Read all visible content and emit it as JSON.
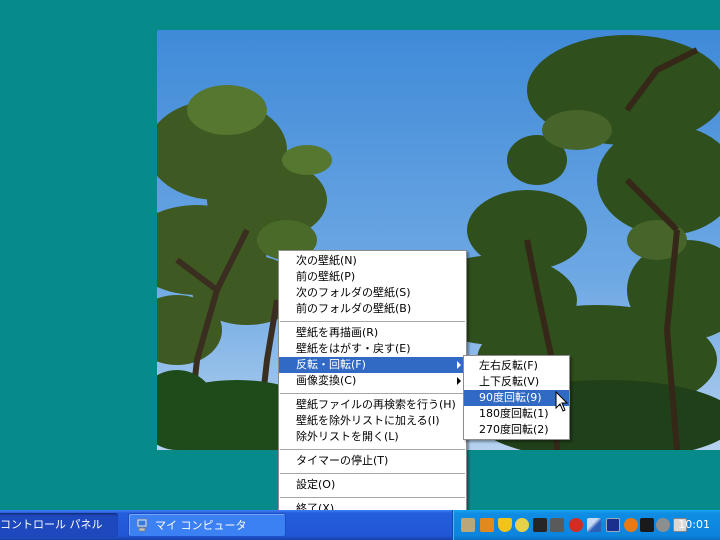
{
  "context_menu": {
    "items": [
      {
        "label": "次の壁紙(N)"
      },
      {
        "label": "前の壁紙(P)"
      },
      {
        "label": "次のフォルダの壁紙(S)"
      },
      {
        "label": "前のフォルダの壁紙(B)"
      },
      {
        "separator": true
      },
      {
        "label": "壁紙を再描画(R)"
      },
      {
        "label": "壁紙をはがす・戻す(E)"
      },
      {
        "label": "反転・回転(F)",
        "submenu": true,
        "highlighted": true
      },
      {
        "label": "画像変換(C)",
        "submenu": true
      },
      {
        "separator": true
      },
      {
        "label": "壁紙ファイルの再検索を行う(H)"
      },
      {
        "label": "壁紙を除外リストに加える(I)"
      },
      {
        "label": "除外リストを開く(L)"
      },
      {
        "separator": true
      },
      {
        "label": "タイマーの停止(T)"
      },
      {
        "separator": true
      },
      {
        "label": "設定(O)"
      },
      {
        "separator": true
      },
      {
        "label": "終了(X)"
      }
    ]
  },
  "sub_menu": {
    "items": [
      {
        "label": "左右反転(F)"
      },
      {
        "label": "上下反転(V)"
      },
      {
        "label": "90度回転(9)",
        "highlighted": true
      },
      {
        "label": "180度回転(1)"
      },
      {
        "label": "270度回転(2)"
      }
    ]
  },
  "taskbar": {
    "buttons": {
      "control_panel": "コントロール パネル",
      "my_computer": "マイ コンピュータ"
    },
    "partial_tray_text": "\"         ט",
    "clock": "10:01",
    "tray_icons": [
      "app-icon",
      "folder-icon",
      "shield-icon",
      "warning-icon",
      "network-icon",
      "tool-icon",
      "bolt-icon",
      "pen-icon",
      "display-icon",
      "volume-icon",
      "speaker-icon",
      "headset-icon",
      "mail-icon"
    ]
  },
  "colors": {
    "desktop": "#078a8a",
    "menu_highlight": "#316ac5",
    "taskbar": "#245edc",
    "tray": "#0f8de3"
  }
}
